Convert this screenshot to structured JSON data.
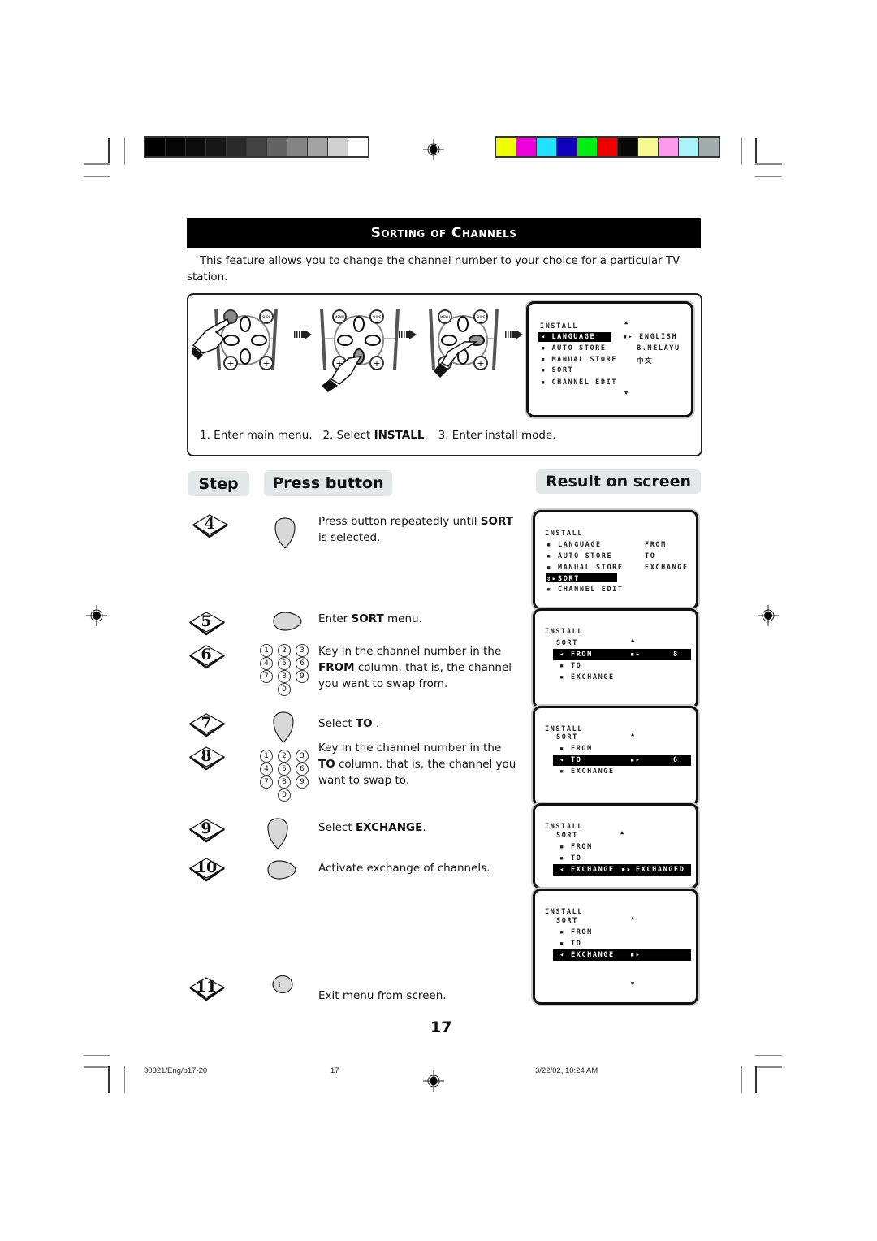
{
  "header": {
    "title": "Sorting of Channels",
    "intro": "This feature allows you to change the channel number to your choice for a particular TV station."
  },
  "calibration": {
    "grayscale": [
      "#000000",
      "#050505",
      "#0c0c0c",
      "#171717",
      "#2a2a2a",
      "#434343",
      "#636363",
      "#838383",
      "#a3a3a3",
      "#d1d1d1",
      "#ffffff"
    ],
    "colors": [
      "#eeff00",
      "#ee00dd",
      "#22e0ff",
      "#1100bb",
      "#00ee11",
      "#ee0000",
      "#080808",
      "#f8f890",
      "#ff99ee",
      "#aaf4fa",
      "#a2acaa"
    ]
  },
  "intro_diagram": {
    "remote_labels": [
      "MENU",
      "SURF"
    ],
    "caption": {
      "step1": "1. Enter main menu.",
      "step2_prefix": "2. Select ",
      "step2_bold": "INSTALL",
      "step2_suffix": ".",
      "step3": "3. Enter install mode."
    },
    "screen": {
      "title": "INSTALL",
      "items": [
        "LANGUAGE",
        "AUTO STORE",
        "MANUAL STORE",
        "SORT",
        "CHANNEL EDIT"
      ],
      "selected": "LANGUAGE",
      "options": [
        "ENGLISH",
        "B.MELAYU",
        "中文"
      ]
    }
  },
  "columns": {
    "step": "Step",
    "press_button": "Press button",
    "result_on_screen": "Result on screen"
  },
  "steps": [
    {
      "num": "4",
      "button": "down-cursor-button",
      "text_parts": [
        "Press button repeatedly until ",
        "SORT",
        " is selected."
      ]
    },
    {
      "num": "5",
      "button": "right-cursor-button",
      "text_parts": [
        "Enter ",
        "SORT",
        " menu."
      ]
    },
    {
      "num": "6",
      "button": "number-keypad",
      "text_parts": [
        "Key in the channel number in the ",
        "FROM",
        " column, that is, the channel you want to swap from."
      ]
    },
    {
      "num": "7",
      "button": "down-cursor-button",
      "text_parts": [
        "Select ",
        "TO",
        " ."
      ]
    },
    {
      "num": "8",
      "button": "number-keypad",
      "text_parts": [
        "Key in the channel number in the ",
        "TO",
        " column. that is, the channel you want to swap to."
      ]
    },
    {
      "num": "9",
      "button": "down-cursor-button",
      "text_parts": [
        "Select ",
        "EXCHANGE",
        "."
      ]
    },
    {
      "num": "10",
      "button": "right-cursor-button",
      "text_parts": [
        "Activate exchange of channels.",
        "",
        ""
      ]
    },
    {
      "num": "11",
      "button": "info-button",
      "text_parts": [
        "Exit menu from screen.",
        "",
        ""
      ]
    }
  ],
  "keypad": [
    "1",
    "2",
    "3",
    "4",
    "5",
    "6",
    "7",
    "8",
    "9",
    "0"
  ],
  "info_button_label": "i",
  "screens": [
    {
      "title": "INSTALL",
      "items": [
        "LANGUAGE",
        "AUTO STORE",
        "MANUAL STORE",
        "SORT",
        "CHANNEL EDIT"
      ],
      "selected": "SORT",
      "options": [
        "FROM",
        "TO",
        "EXCHANGE"
      ]
    },
    {
      "title": "INSTALL",
      "sub": "SORT",
      "items": [
        "FROM",
        "TO",
        "EXCHANGE"
      ],
      "selected": "FROM",
      "value": "8"
    },
    {
      "title": "INSTALL",
      "sub": "SORT",
      "items": [
        "FROM",
        "TO",
        "EXCHANGE"
      ],
      "selected": "TO",
      "value": "6"
    },
    {
      "title": "INSTALL",
      "sub": "SORT",
      "items": [
        "FROM",
        "TO",
        "EXCHANGE"
      ],
      "selected": "EXCHANGE",
      "value": "EXCHANGED"
    },
    {
      "title": "INSTALL",
      "sub": "SORT",
      "items": [
        "FROM",
        "TO",
        "EXCHANGE"
      ],
      "selected": "EXCHANGE",
      "value": ""
    }
  ],
  "page_number": "17",
  "footer": {
    "file": "30321/Eng/p17-20",
    "page": "17",
    "timestamp": "3/22/02, 10:24 AM"
  }
}
